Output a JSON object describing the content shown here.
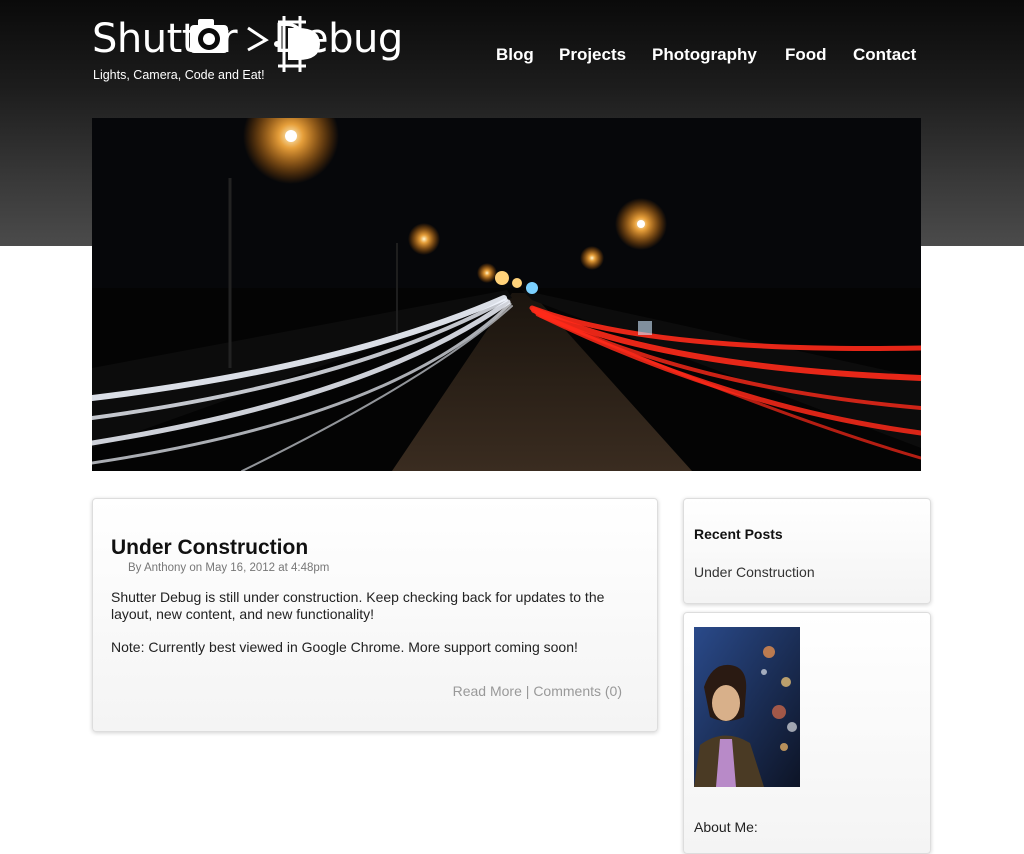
{
  "site": {
    "logo_text": "Shutter Debug",
    "tagline": "Lights, Camera, Code and Eat!"
  },
  "nav": {
    "items": [
      {
        "label": "Blog"
      },
      {
        "label": "Projects"
      },
      {
        "label": "Photography"
      },
      {
        "label": "Food"
      },
      {
        "label": "Contact"
      }
    ]
  },
  "post": {
    "title": "Under Construction",
    "meta": "By Anthony on May 16, 2012 at 4:48pm",
    "body": [
      "Shutter Debug is still under construction. Keep checking back for updates to the layout, new content, and new functionality!",
      "Note: Currently best viewed in Google Chrome. More support coming soon!"
    ],
    "read_more": "Read More",
    "separator": " | ",
    "comments": "Comments (0)"
  },
  "sidebar": {
    "recent_title": "Recent Posts",
    "recent_items": [
      "Under Construction"
    ],
    "about_label": "About Me:"
  },
  "colors": {
    "header_dark": "#0a0a0a",
    "header_light": "#4b4b4b",
    "trail_red": "#ff2a1a",
    "trail_white": "#f2f6ff",
    "streetlight": "#ffb040"
  }
}
